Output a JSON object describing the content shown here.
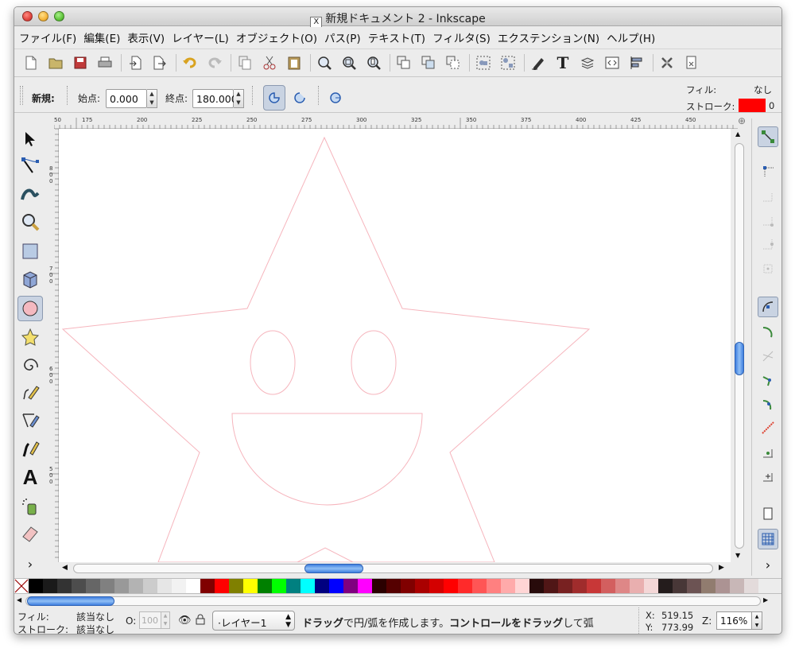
{
  "window": {
    "title": "新規ドキュメント 2 - Inkscape",
    "title_icon": "X"
  },
  "menu": [
    "ファイル(F)",
    "編集(E)",
    "表示(V)",
    "レイヤー(L)",
    "オブジェクト(O)",
    "パス(P)",
    "テキスト(T)",
    "フィルタ(S)",
    "エクステンション(N)",
    "ヘルプ(H)"
  ],
  "toolbar_icons": [
    "new-document-icon",
    "open-icon",
    "save-icon",
    "print-icon",
    "import-icon",
    "export-icon",
    "undo-icon",
    "redo-icon",
    "copy-icon",
    "cut-icon",
    "paste-icon",
    "zoom-selection-icon",
    "zoom-drawing-icon",
    "zoom-page-icon",
    "duplicate-icon",
    "clone-icon",
    "unlink-clone-icon",
    "group-icon",
    "ungroup-icon",
    "fill-stroke-icon",
    "text-tool-icon",
    "layers-icon",
    "xml-editor-icon",
    "align-icon",
    "preferences-icon",
    "document-properties-icon"
  ],
  "controls": {
    "tool_name": "新規:",
    "start_label": "始点:",
    "start_value": "0.000",
    "end_label": "終点:",
    "end_value": "180.000",
    "fill_label": "フィル:",
    "fill_value": "なし",
    "stroke_label": "ストローク:",
    "stroke_width": "0",
    "stroke_color": "#ff0000"
  },
  "ruler": {
    "top_labels": [
      "50",
      "175",
      "200",
      "225",
      "250",
      "275",
      "300",
      "325",
      "350",
      "375",
      "400",
      "425",
      "450"
    ],
    "left_labels": [
      "800",
      "700",
      "600",
      "500"
    ]
  },
  "palette_colors": [
    "#000000",
    "#1a1a1a",
    "#333333",
    "#4d4d4d",
    "#666666",
    "#808080",
    "#999999",
    "#b3b3b3",
    "#cccccc",
    "#e6e6e6",
    "#f2f2f2",
    "#ffffff",
    "#800000",
    "#ff0000",
    "#808000",
    "#ffff00",
    "#008000",
    "#00ff00",
    "#008080",
    "#00ffff",
    "#000080",
    "#0000ff",
    "#800080",
    "#ff00ff",
    "#2b0000",
    "#550000",
    "#800000",
    "#aa0000",
    "#d40000",
    "#ff0000",
    "#ff2a2a",
    "#ff5555",
    "#ff8080",
    "#ffaaaa",
    "#ffd5d5",
    "#280b0b",
    "#501616",
    "#782121",
    "#a02c2c",
    "#c83737",
    "#d35f5f",
    "#de8787",
    "#e9afaf",
    "#f4d7d7",
    "#241c1c",
    "#483737",
    "#6c5353",
    "#917c6f",
    "#ac9393",
    "#c8b7b7",
    "#e3dbdb"
  ],
  "status": {
    "fill_label": "フィル:",
    "fill_value": "該当なし",
    "stroke_label": "ストローク:",
    "stroke_value": "該当なし",
    "opacity_label": "O:",
    "opacity_value": "100",
    "layer": "·レイヤー1",
    "message_bold1": "ドラッグ",
    "message_1": "で円/弧を作成します。",
    "message_bold2": "コントロールをドラッグ",
    "message_2": "して弧",
    "x_label": "X:",
    "x_value": "519.15",
    "y_label": "Y:",
    "y_value": "773.99",
    "zoom_label": "Z:",
    "zoom_value": "116%"
  }
}
